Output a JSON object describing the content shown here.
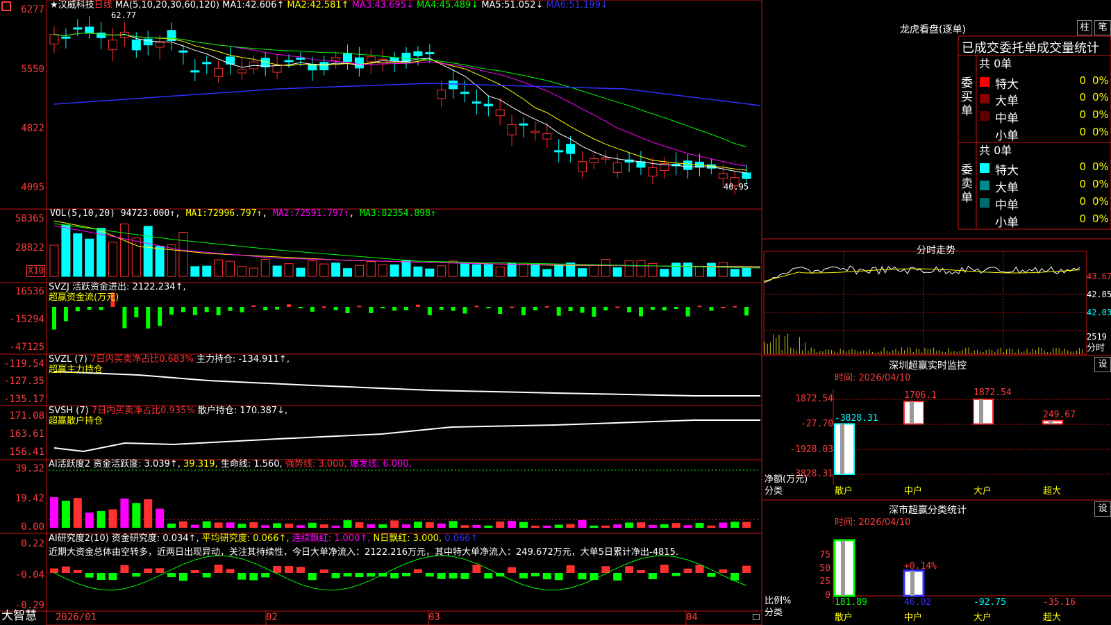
{
  "top_left_icon": "red-square-icon",
  "stock_title": "★汉威科技",
  "period_label": "日线",
  "ma_header": {
    "label": "MA(5,10,20,30,60,120)",
    "items": [
      {
        "name": "MA1:",
        "value": "42.606↑",
        "color": "#ffffff"
      },
      {
        "name": "MA2:",
        "value": "42.581↑",
        "color": "#ffff00"
      },
      {
        "name": "MA3:",
        "value": "43.695↓",
        "color": "#ff00ff"
      },
      {
        "name": "MA4:",
        "value": "45.489↓",
        "color": "#00ff00"
      },
      {
        "name": "MA5:",
        "value": "51.052↓",
        "color": "#ffffff"
      },
      {
        "name": "MA6:",
        "value": "51.199↓",
        "color": "#3030ff"
      }
    ]
  },
  "price_axis": [
    "6277",
    "5550",
    "4822",
    "4095"
  ],
  "price_high_label": "62.77",
  "price_low_label": "40.95",
  "vol_header": {
    "label": "VOL(5,10,20)",
    "value": "94723.000↑",
    "items": [
      {
        "name": "MA1:",
        "value": "72996.797↑",
        "color": "#ffff00"
      },
      {
        "name": "MA2:",
        "value": "72591.797↑",
        "color": "#ff00ff"
      },
      {
        "name": "MA3:",
        "value": "82354.898↑",
        "color": "#00ff00"
      }
    ]
  },
  "vol_axis": [
    "58365",
    "28822"
  ],
  "vol_unit": "X10",
  "svzj": {
    "label": "SVZJ",
    "line1": "活跃资金进出: 2122.234↑,",
    "line2": "超赢资金流(万元)",
    "axis": [
      "16536",
      "-15294",
      "-47125"
    ]
  },
  "svzl": {
    "label": "SVZL (7)",
    "pct": "7日内买卖净占比0.683%",
    "hold": "主力持仓: -134.911↑,",
    "line2": "超赢主力持仓",
    "axis": [
      "-119.54",
      "-127.35",
      "-135.17"
    ]
  },
  "svsh": {
    "label": "SVSH (7)",
    "pct": "7日内买卖净占比0.935%",
    "hold": "散户持仓: 170.387↓,",
    "line2": "超赢散户持仓",
    "axis": [
      "171.08",
      "163.61",
      "156.41"
    ]
  },
  "ai_active": {
    "label": "AI活跃度2",
    "items": [
      {
        "text": "资金活跃度: 3.039↑,",
        "color": "#ffffff"
      },
      {
        "text": "39.319,",
        "color": "#ffff00"
      },
      {
        "text": "生命线: 1.560,",
        "color": "#ffffff"
      },
      {
        "text": "强势线: 3.000,",
        "color": "#ff3030"
      },
      {
        "text": "爆发线: 6.000,",
        "color": "#ff00ff"
      }
    ],
    "axis": [
      "39.32",
      "19.42",
      "0.00"
    ]
  },
  "ai_research": {
    "label": "AI研究度2(10)",
    "items": [
      {
        "text": "资金研究度: 0.034↑,",
        "color": "#ffffff"
      },
      {
        "text": "平均研究度: 0.066↑,",
        "color": "#ffff00"
      },
      {
        "text": "连续飘红: 1.000↑,",
        "color": "#ff00ff"
      },
      {
        "text": "N日飘红: 3.000,",
        "color": "#ffff00"
      },
      {
        "text": "0.066↑",
        "color": "#3030ff"
      }
    ],
    "comment": "近期大资金总体由空转多，近两日出现异动，关注其持续性，今日大单净流入：2122.216万元，其中特大单净流入：249.672万元，大单5日累计净出-4815.",
    "axis": [
      "0.22",
      "-0.04",
      "-0.29"
    ]
  },
  "date_axis": [
    "2026/01",
    "02",
    "03",
    "04"
  ],
  "bottom_brand": "大智慧",
  "lhb": {
    "title": "龙虎看盘(逐单)",
    "btn1": "柱",
    "btn2": "笔",
    "subtitle": "已成交委托单成交量统计",
    "buy_label": "委买单",
    "sell_label": "委卖单",
    "buy_total": "共 0单",
    "sell_total": "共 0单",
    "buy": [
      {
        "name": "特大",
        "count": "0",
        "pct": "0%",
        "color": "#ff0000"
      },
      {
        "name": "大单",
        "count": "0",
        "pct": "0%",
        "color": "#8b0000"
      },
      {
        "name": "中单",
        "count": "0",
        "pct": "0%",
        "color": "#5a0000"
      },
      {
        "name": "小单",
        "count": "0",
        "pct": "0%",
        "color": "#000000"
      }
    ],
    "sell": [
      {
        "name": "特大",
        "count": "0",
        "pct": "0%",
        "color": "#00ffff"
      },
      {
        "name": "大单",
        "count": "0",
        "pct": "0%",
        "color": "#008b8b"
      },
      {
        "name": "中单",
        "count": "0",
        "pct": "0%",
        "color": "#006a6a"
      },
      {
        "name": "小单",
        "count": "0",
        "pct": "0%",
        "color": "#000000"
      }
    ]
  },
  "intraday": {
    "title": "分时走势",
    "axis": [
      "43.67",
      "42.85",
      "42.03",
      "2519"
    ],
    "unit": "分时"
  },
  "sz_monitor": {
    "title": "深圳超赢实时监控",
    "btn": "设",
    "time": "时间: 2026/04/10",
    "axis": [
      "1872.54",
      "-27.70",
      "-1928.03",
      "-3828.31"
    ],
    "ylabel1": "净额(万元)",
    "ylabel2": "分类",
    "chart_data": {
      "type": "bar",
      "categories": [
        "散户",
        "中户",
        "大户",
        "超大"
      ],
      "values": [
        -3828.31,
        1706.1,
        1872.54,
        249.67
      ],
      "value_labels": [
        "-3828.31",
        "1706.1",
        "1872.54",
        "249.67"
      ],
      "ylim": [
        -3828.31,
        1872.54
      ]
    }
  },
  "sz_classify": {
    "title": "深市超赢分类统计",
    "btn": "设",
    "time": "时间: 2026/04/10",
    "axis": [
      "75",
      "50",
      "25",
      "0"
    ],
    "ylabel1": "比例%",
    "ylabel2": "分类",
    "pct_label": "+0.14%",
    "chart_data": {
      "type": "bar",
      "categories": [
        "散户",
        "中户",
        "大户",
        "超大"
      ],
      "values": [
        181.89,
        46.02,
        -92.75,
        -35.16
      ],
      "value_labels": [
        "181.89",
        "46.02",
        "-92.75",
        "-35.16"
      ],
      "ylim": [
        0,
        75
      ]
    }
  }
}
